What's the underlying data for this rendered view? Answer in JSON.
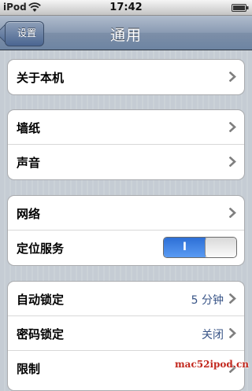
{
  "status_bar": {
    "carrier": "iPod",
    "time": "17:42",
    "wifi_icon": "wifi-icon",
    "battery_icon": "battery-icon"
  },
  "nav": {
    "back_label": "设置",
    "title": "通用"
  },
  "groups": [
    {
      "rows": [
        {
          "label": "关于本机",
          "accessory": "chevron"
        }
      ]
    },
    {
      "rows": [
        {
          "label": "墙纸",
          "accessory": "chevron"
        },
        {
          "label": "声音",
          "accessory": "chevron"
        }
      ]
    },
    {
      "rows": [
        {
          "label": "网络",
          "accessory": "chevron"
        },
        {
          "label": "定位服务",
          "accessory": "toggle",
          "toggle_text": "I",
          "toggle_on": true
        }
      ]
    },
    {
      "rows": [
        {
          "label": "自动锁定",
          "value": "5 分钟",
          "accessory": "chevron"
        },
        {
          "label": "密码锁定",
          "value": "关闭",
          "accessory": "chevron"
        },
        {
          "label": "限制",
          "accessory": "chevron"
        }
      ]
    }
  ],
  "watermark": "mac52ipod.cn",
  "colors": {
    "nav_bar": "#6d84a2",
    "toggle_on": "#2d6fd6",
    "value_text": "#385487",
    "watermark": "#c2271d"
  }
}
